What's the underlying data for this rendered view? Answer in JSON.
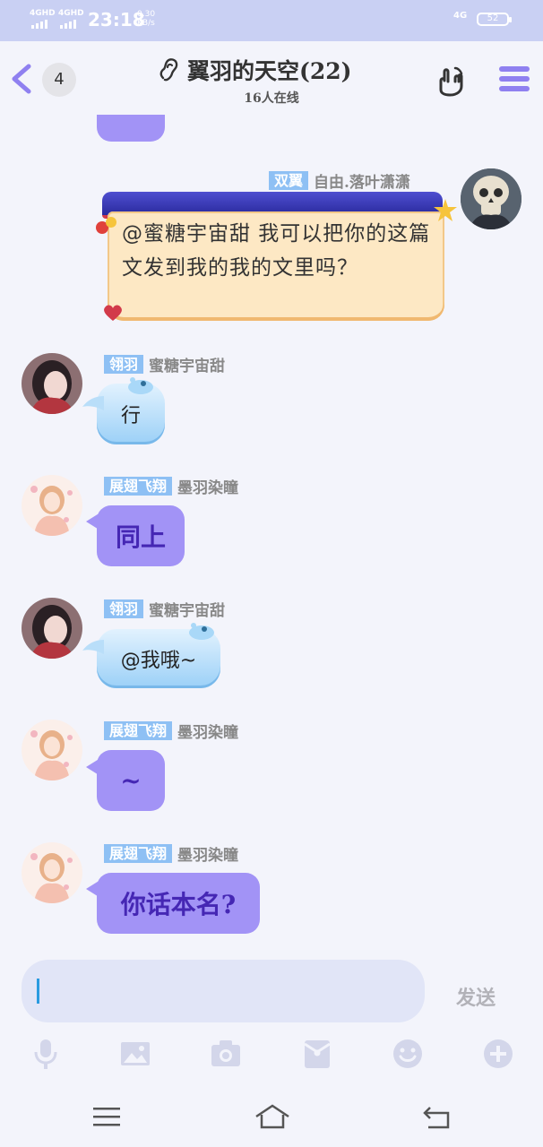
{
  "status_bar": {
    "signal_1": "4GHD",
    "signal_2": "4GHD",
    "time": "23:18",
    "speed_value": "0.30",
    "speed_unit": "KB/s",
    "network": "4G",
    "battery": "52"
  },
  "header": {
    "unread_count": "4",
    "title": "翼羽的天空(22)",
    "subtitle": "16人在线"
  },
  "messages": [
    {
      "side": "right",
      "tag": "双翼",
      "name": "自由.落叶潇潇",
      "text": "@蜜糖宇宙甜 我可以把你的这篇文发到我的我的文里吗？"
    },
    {
      "tag": "翎羽",
      "name": "蜜糖宇宙甜",
      "text": "行"
    },
    {
      "tag": "展翅飞翔",
      "name": "墨羽染瞳",
      "text": "同上"
    },
    {
      "tag": "翎羽",
      "name": "蜜糖宇宙甜",
      "text": "@我哦~"
    },
    {
      "tag": "展翅飞翔",
      "name": "墨羽染瞳",
      "text": "~"
    },
    {
      "tag": "展翅飞翔",
      "name": "墨羽染瞳",
      "text": "你话本名?"
    }
  ],
  "input": {
    "value": "",
    "send_label": "发送"
  },
  "colors": {
    "accent": "#8f80f0",
    "bubble_purple": "#a293f6",
    "bubble_text": "#4527b4",
    "tag_blue": "#8ec0f4",
    "status_bar": "#c9d0f3",
    "background": "#f3f4fb"
  },
  "icons": {
    "back": "back-arrow-icon",
    "ear": "ear-icon",
    "hand": "hand-gesture-icon",
    "menu": "menu-icon",
    "tools": [
      "microphone-icon",
      "image-icon",
      "camera-icon",
      "red-packet-icon",
      "emoji-icon",
      "plus-icon"
    ],
    "nav": [
      "recent-apps-icon",
      "home-icon",
      "back-icon"
    ]
  }
}
